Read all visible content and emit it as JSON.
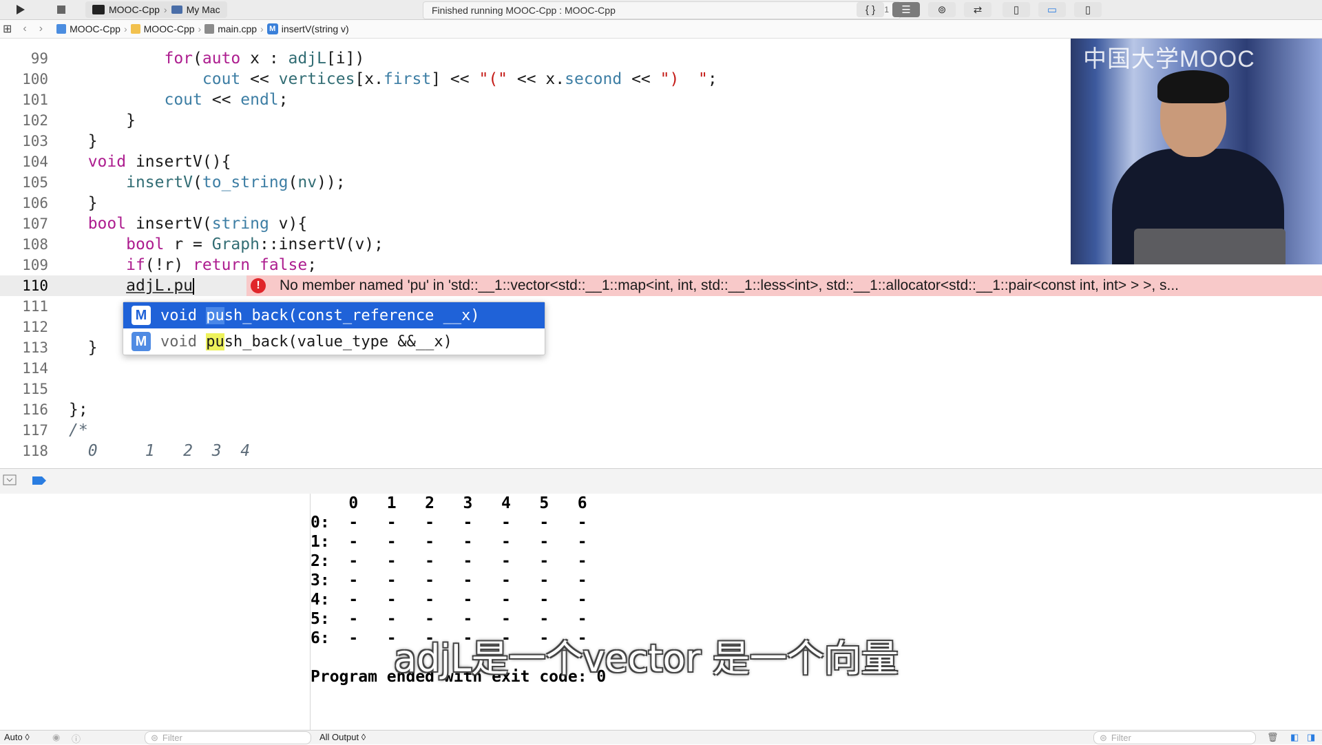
{
  "toolbar": {
    "scheme_name": "MOOC-Cpp",
    "destination": "My Mac",
    "status_text": "Finished running MOOC-Cpp : MOOC-Cpp",
    "error_count": "1",
    "right_icons": [
      "braces-icon",
      "lines-icon",
      "venn-icon",
      "swap-arrows-icon",
      "panel-left-icon",
      "panel-bottom-icon",
      "panel-right-icon"
    ]
  },
  "jumpbar": {
    "project": "MOOC-Cpp",
    "folder": "MOOC-Cpp",
    "file": "main.cpp",
    "symbol_badge": "M",
    "symbol": "insertV(string v)"
  },
  "editor": {
    "lines": [
      {
        "n": "99"
      },
      {
        "n": "100"
      },
      {
        "n": "101"
      },
      {
        "n": "102"
      },
      {
        "n": "103"
      },
      {
        "n": "104"
      },
      {
        "n": "105"
      },
      {
        "n": "106"
      },
      {
        "n": "107"
      },
      {
        "n": "108"
      },
      {
        "n": "109"
      },
      {
        "n": "110"
      },
      {
        "n": "111"
      },
      {
        "n": "112"
      },
      {
        "n": "113"
      },
      {
        "n": "114"
      },
      {
        "n": "115"
      },
      {
        "n": "116"
      },
      {
        "n": "117"
      },
      {
        "n": "118"
      }
    ],
    "error_message": "No member named 'pu' in 'std::__1::vector<std::__1::map<int, int, std::__1::less<int>, std::__1::allocator<std::__1::pair<const int, int> > >, s...",
    "error_glyph": "!"
  },
  "completion": {
    "items": [
      {
        "badge": "M",
        "ret": "void",
        "match": "pu",
        "rest": "sh_back(const_reference __x)"
      },
      {
        "badge": "M",
        "ret": "void",
        "match": "pu",
        "rest": "sh_back(value_type &&__x)"
      }
    ]
  },
  "video": {
    "logo": "中国大学MOOC"
  },
  "console": {
    "header": "    0   1   2   3   4   5   6",
    "rows": [
      "0:  -   -   -   -   -   -   -",
      "1:  -   -   -   -   -   -   -",
      "2:  -   -   -   -   -   -   -",
      "3:  -   -   -   -   -   -   -",
      "4:  -   -   -   -   -   -   -",
      "5:  -   -   -   -   -   -   -",
      "6:  -   -   -   -   -   -   -"
    ],
    "exit_message": "Program ended with exit code: 0"
  },
  "subtitle": "adjL是一个vector 是一个向量",
  "footer": {
    "auto_label": "Auto ◊",
    "filter_placeholder_left": "Filter",
    "output_selector": "All Output ◊",
    "filter_placeholder_right": "Filter"
  }
}
